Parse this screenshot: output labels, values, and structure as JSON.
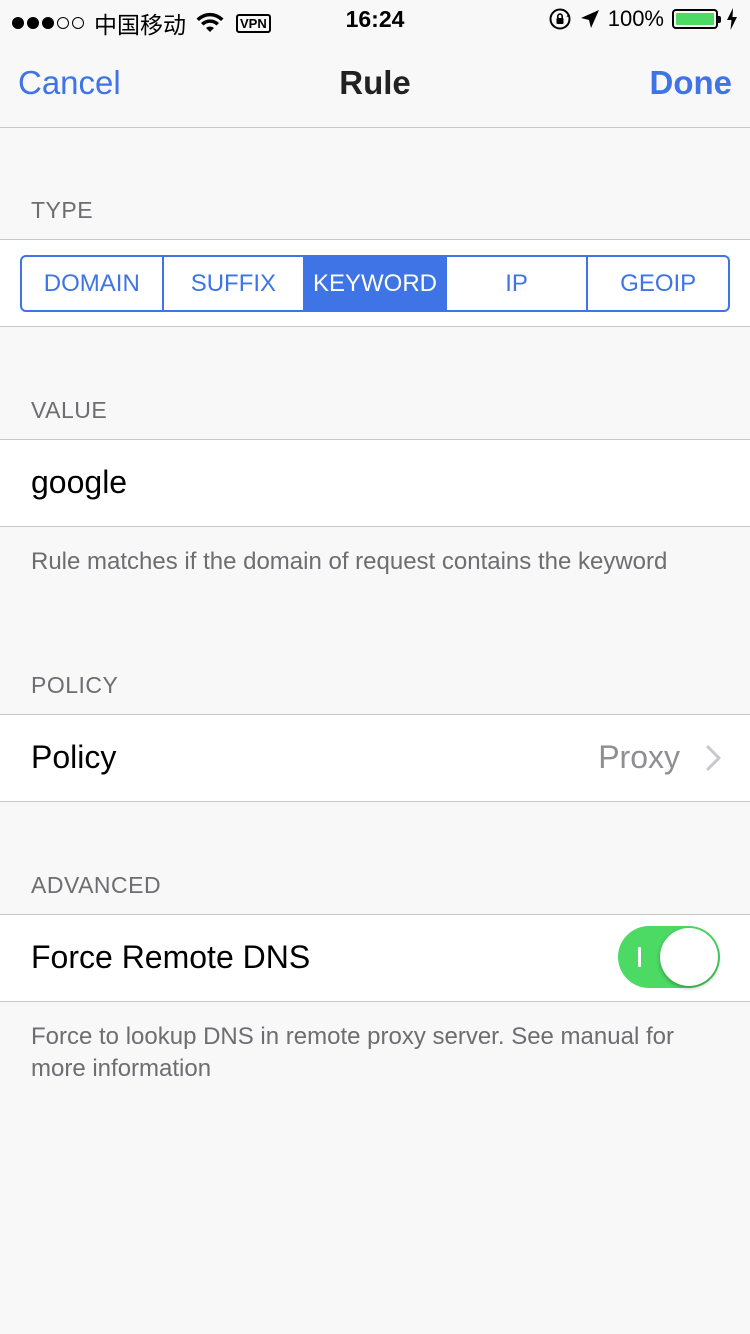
{
  "status_bar": {
    "carrier": "中国移动",
    "vpn": "VPN",
    "time": "16:24",
    "battery": "100%",
    "icons": [
      "signal-dots",
      "wifi-icon",
      "vpn-badge",
      "rotation-lock-icon",
      "location-arrow-icon",
      "battery-icon",
      "charging-bolt-icon"
    ]
  },
  "nav": {
    "cancel": "Cancel",
    "title": "Rule",
    "done": "Done"
  },
  "type_section": {
    "header": "TYPE",
    "segments": [
      "DOMAIN",
      "SUFFIX",
      "KEYWORD",
      "IP",
      "GEOIP"
    ],
    "selected": "KEYWORD"
  },
  "value_section": {
    "header": "VALUE",
    "value": "google",
    "footer": "Rule matches if the domain of request contains the keyword"
  },
  "policy_section": {
    "header": "POLICY",
    "label": "Policy",
    "value": "Proxy"
  },
  "advanced_section": {
    "header": "ADVANCED",
    "label": "Force Remote DNS",
    "enabled": true,
    "footer": "Force to lookup DNS in remote proxy server. See manual for more information"
  },
  "colors": {
    "accent": "#3e74e6",
    "toggle_on": "#4cd964",
    "background": "#f8f8f8",
    "secondary_text": "#6d6d72"
  }
}
